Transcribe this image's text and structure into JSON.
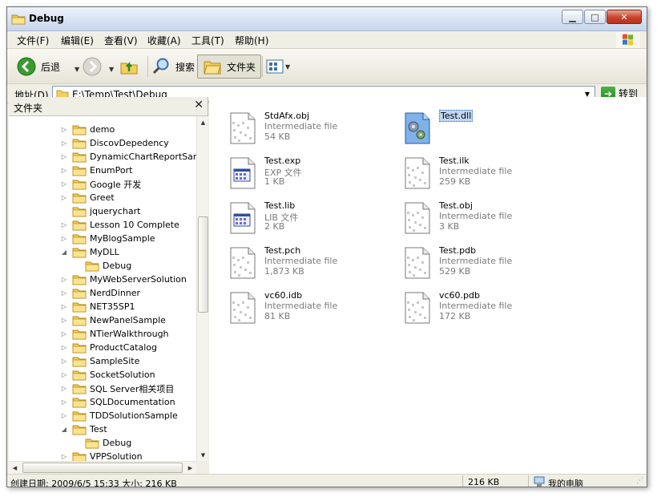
{
  "window": {
    "title": "Debug"
  },
  "menu": [
    "文件(F)",
    "编辑(E)",
    "查看(V)",
    "收藏(A)",
    "工具(T)",
    "帮助(H)"
  ],
  "toolbar": {
    "back": "后退",
    "search": "搜索",
    "folders": "文件夹"
  },
  "address": {
    "label": "地址(D)",
    "path": "E:\\Temp\\Test\\Debug",
    "go": "转到"
  },
  "folders_pane": {
    "title": "文件夹",
    "items": [
      {
        "label": "demo",
        "expanded": false
      },
      {
        "label": "DiscovDepedency",
        "expanded": false
      },
      {
        "label": "DynamicChartReportSample",
        "expanded": false
      },
      {
        "label": "EnumPort",
        "expanded": false
      },
      {
        "label": "Google 开发",
        "expanded": false
      },
      {
        "label": "Greet",
        "expanded": false
      },
      {
        "label": "jquerychart",
        "expanded": null
      },
      {
        "label": "Lesson 10 Complete",
        "expanded": false
      },
      {
        "label": "MyBlogSample",
        "expanded": false
      },
      {
        "label": "MyDLL",
        "expanded": true
      },
      {
        "label": "Debug",
        "expanded": null,
        "child": true
      },
      {
        "label": "MyWebServerSolution",
        "expanded": false
      },
      {
        "label": "NerdDinner",
        "expanded": false
      },
      {
        "label": "NET35SP1",
        "expanded": false
      },
      {
        "label": "NewPanelSample",
        "expanded": false
      },
      {
        "label": "NTierWalkthrough",
        "expanded": false
      },
      {
        "label": "ProductCatalog",
        "expanded": false
      },
      {
        "label": "SampleSite",
        "expanded": false
      },
      {
        "label": "SocketSolution",
        "expanded": false
      },
      {
        "label": "SQL Server相关项目",
        "expanded": false
      },
      {
        "label": "SQLDocumentation",
        "expanded": false
      },
      {
        "label": "TDDSolutionSample",
        "expanded": false
      },
      {
        "label": "Test",
        "expanded": true
      },
      {
        "label": "Debug",
        "expanded": null,
        "child": true
      },
      {
        "label": "VPPSolution",
        "expanded": false
      }
    ]
  },
  "files": [
    {
      "name": "StdAfx.obj",
      "type": "Intermediate file",
      "size": "54 KB",
      "icon": "generic-file-icon"
    },
    {
      "name": "Test.dll",
      "type": "",
      "size": "",
      "icon": "dll-file-icon",
      "selected": true
    },
    {
      "name": "Test.exp",
      "type": "EXP 文件",
      "size": "1 KB",
      "icon": "window-file-icon"
    },
    {
      "name": "Test.ilk",
      "type": "Intermediate file",
      "size": "259 KB",
      "icon": "generic-file-icon"
    },
    {
      "name": "Test.lib",
      "type": "LIB 文件",
      "size": "2 KB",
      "icon": "window-file-icon"
    },
    {
      "name": "Test.obj",
      "type": "Intermediate file",
      "size": "3 KB",
      "icon": "generic-file-icon"
    },
    {
      "name": "Test.pch",
      "type": "Intermediate file",
      "size": "1,873 KB",
      "icon": "generic-file-icon"
    },
    {
      "name": "Test.pdb",
      "type": "Intermediate file",
      "size": "529 KB",
      "icon": "generic-file-icon"
    },
    {
      "name": "vc60.idb",
      "type": "Intermediate file",
      "size": "81 KB",
      "icon": "generic-file-icon"
    },
    {
      "name": "vc60.pdb",
      "type": "Intermediate file",
      "size": "172 KB",
      "icon": "generic-file-icon"
    }
  ],
  "status": {
    "info": "创建日期: 2009/6/5 15:33 大小: 216 KB",
    "size": "216 KB",
    "location": "我的电脑"
  },
  "colors": {
    "folder": "#f2cf58",
    "selection": "#c1d8f5",
    "accent": "#316ac5"
  }
}
